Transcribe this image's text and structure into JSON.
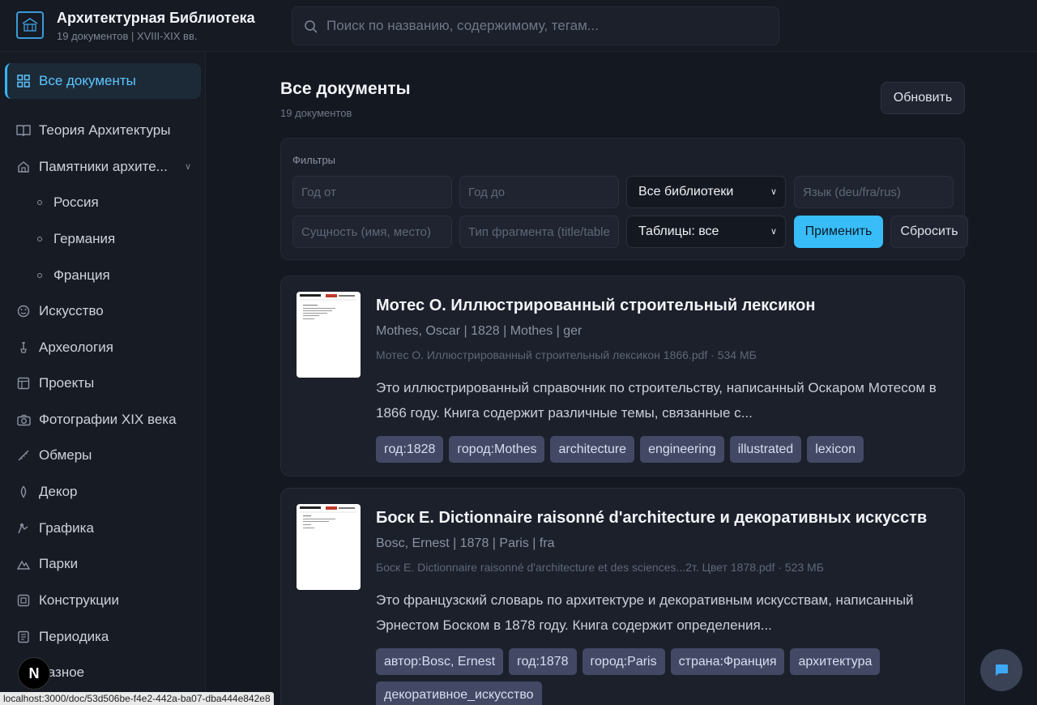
{
  "app": {
    "title": "Архитектурная Библиотека",
    "subtitle": "19 документов | XVIII-XIX вв."
  },
  "search": {
    "placeholder": "Поиск по названию, содержимому, тегам..."
  },
  "sidebar": {
    "items": [
      {
        "label": "Все документы",
        "icon": "grid-icon",
        "active": true
      },
      {
        "label": "Теория Архитектуры",
        "icon": "book-open-icon"
      },
      {
        "label": "Памятники архите...",
        "icon": "home-icon",
        "expanded": true
      },
      {
        "label": "Россия",
        "icon": "circle-icon",
        "sub": true
      },
      {
        "label": "Германия",
        "icon": "circle-icon",
        "sub": true
      },
      {
        "label": "Франция",
        "icon": "circle-icon",
        "sub": true
      },
      {
        "label": "Искусство",
        "icon": "palette-icon"
      },
      {
        "label": "Археология",
        "icon": "shovel-icon"
      },
      {
        "label": "Проекты",
        "icon": "layout-icon"
      },
      {
        "label": "Фотографии XIX века",
        "icon": "camera-icon"
      },
      {
        "label": "Обмеры",
        "icon": "ruler-icon"
      },
      {
        "label": "Декор",
        "icon": "leaf-icon"
      },
      {
        "label": "Графика",
        "icon": "pen-tool-icon"
      },
      {
        "label": "Парки",
        "icon": "mountain-icon"
      },
      {
        "label": "Конструкции",
        "icon": "columns-icon"
      },
      {
        "label": "Периодика",
        "icon": "newspaper-icon"
      },
      {
        "label": "Разное",
        "icon": "more-icon"
      }
    ]
  },
  "main": {
    "title": "Все документы",
    "count": "19 документов",
    "refresh_label": "Обновить"
  },
  "filters": {
    "label": "Фильтры",
    "year_from_placeholder": "Год от",
    "year_to_placeholder": "Год до",
    "library_select": "Все библиотеки",
    "language_placeholder": "Язык (deu/fra/rus)",
    "entity_placeholder": "Сущность (имя, место)",
    "fragment_placeholder": "Тип фрагмента (title/table)",
    "tables_select": "Таблицы: все",
    "apply_label": "Применить",
    "reset_label": "Сбросить"
  },
  "documents": [
    {
      "title": "Мотес О. Иллюстрированный строительный лексикон",
      "meta": "Mothes, Oscar | 1828 | Mothes | ger",
      "file": "Мотес О. Иллюстрированный строительный лексикон 1866.pdf · 534 МБ",
      "description": "Это иллюстрированный справочник по строительству, написанный Оскаром Мотесом в 1866 году. Книга содержит различные темы, связанные с...",
      "tags": [
        "год:1828",
        "город:Mothes",
        "architecture",
        "engineering",
        "illustrated",
        "lexicon"
      ]
    },
    {
      "title": "Боск Е. Dictionnaire raisonné d'architecture и декоративных искусств",
      "meta": "Bosc, Ernest | 1878 | Paris | fra",
      "file": "Боск Е. Dictionnaire raisonné d'architecture et des sciences...2т. Цвет 1878.pdf · 523 МБ",
      "description": "Это французский словарь по архитектуре и декоративным искусствам, написанный Эрнестом Боском в 1878 году. Книга содержит определения...",
      "tags": [
        "автор:Bosc, Ernest",
        "год:1878",
        "город:Paris",
        "страна:Франция",
        "архитектура",
        "декоративное_искусство"
      ]
    }
  ],
  "status_url": "localhost:3000/doc/53d506be-f4e2-442a-ba07-dba444e842e8",
  "overlay_badge": "N",
  "colors": {
    "accent": "#38bdf8",
    "tag_bg": "#434965",
    "bg": "#141821"
  }
}
